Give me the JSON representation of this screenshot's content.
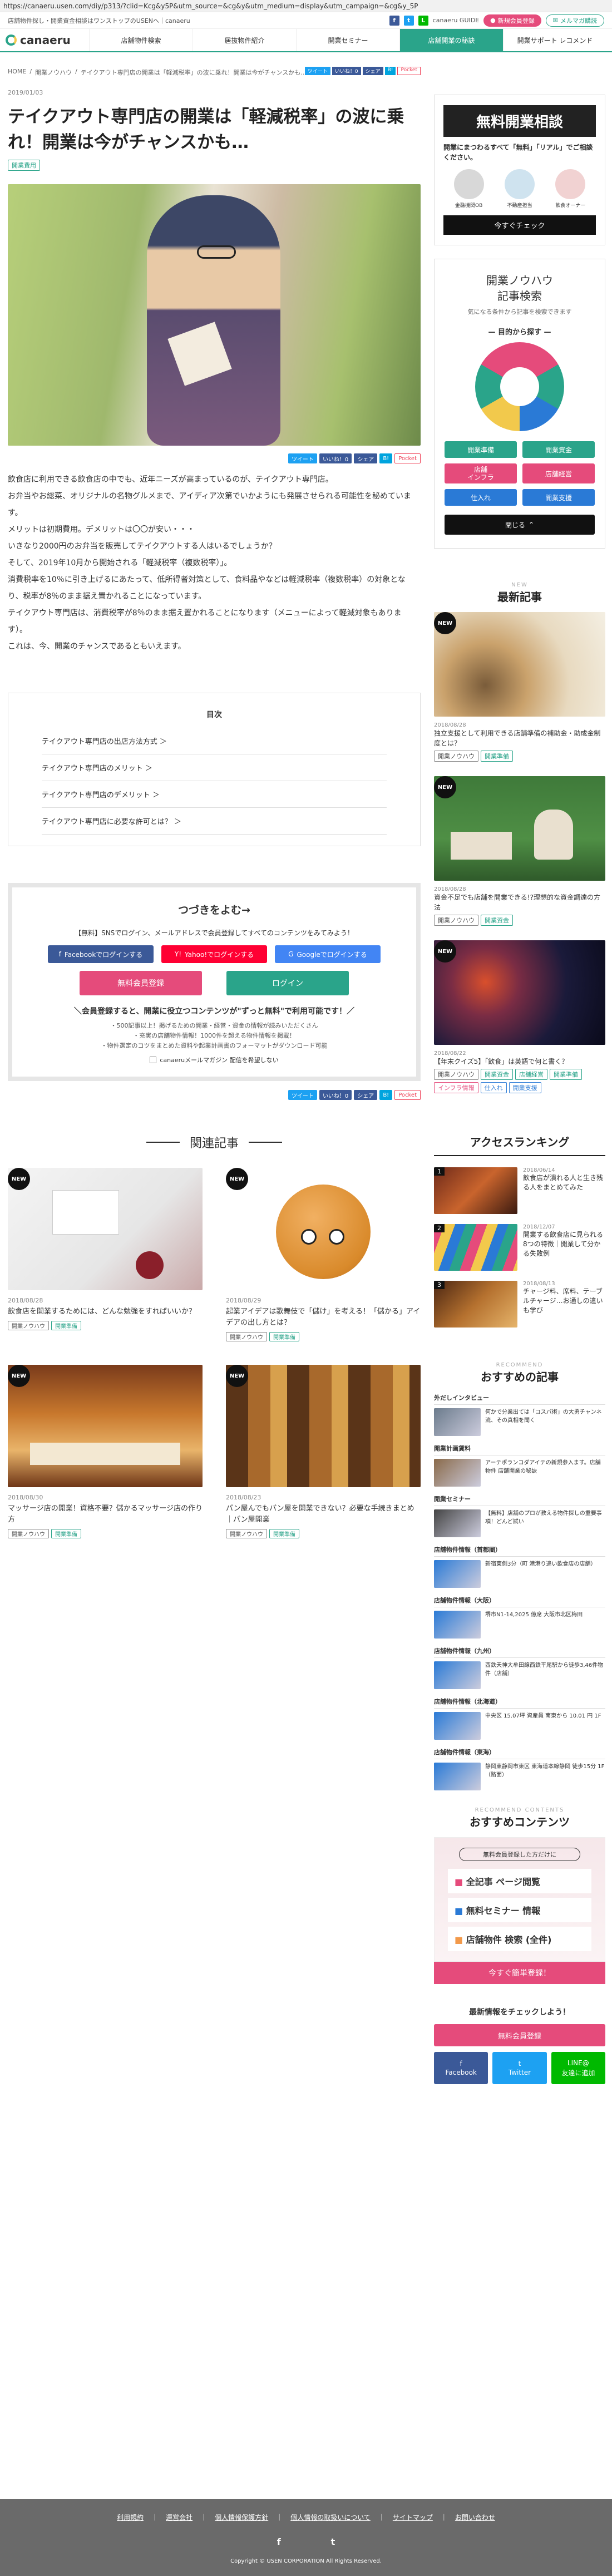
{
  "browser": {
    "url": "https://canaeru.usen.com/diy/p313/?clid=Kcg&y5P&utm_source=&cg&y&utm_medium=display&utm_campaign=&cg&y_5P"
  },
  "topbar": {
    "tagline": "店舗物件探し・開業資金相談はワンストップのUSENへ｜canaeru",
    "guide_label": "canaeru GUIDE",
    "new_register_label": "新規会員登録",
    "mail_label": "メルマガ購読"
  },
  "nav": {
    "logo": "canaeru",
    "items": [
      "店舗物件検索",
      "居抜物件紹介",
      "開業セミナー",
      "店舗開業の秘訣",
      "開業サポート レコメンド"
    ]
  },
  "breadcrumb": [
    "HOME",
    "開業ノウハウ",
    "テイクアウト専門店の開業は「軽減税率」の波に乗れ！開業は今がチャンスかも…"
  ],
  "article": {
    "date": "2019/01/03",
    "title": "テイクアウト専門店の開業は「軽減税率」の波に乗れ！開業は今がチャンスかも…",
    "category": "開業費用",
    "share": {
      "tweet": "ツイート",
      "like": "いいね！0",
      "share": "シェア",
      "hatena": "B!",
      "pocket": "Pocket"
    },
    "paragraphs": [
      "飲食店に利用できる飲食店の中でも、近年ニーズが高まっているのが、テイクアウト専門店。",
      "お弁当やお総菜、オリジナルの名物グルメまで、アイディア次第でいかようにも発展させられる可能性を秘めています。",
      "メリットは初期費用。デメリットは〇〇が安い・・・",
      "いきなり2000円のお弁当を販売してテイクアウトする人はいるでしょうか？",
      "そして、2019年10月から開始される「軽減税率（複数税率）」。",
      "消費税率を10％に引き上げるにあたって、低所得者対策として、食料品やなどは軽減税率（複数税率）の対象となり、税率が8％のまま据え置かれることになっています。",
      "テイクアウト専門店は、消費税率が8％のまま据え置かれることになります（メニューによって軽減対象もあります）。",
      "これは、今、開業のチャンスであるともいえます。"
    ],
    "toc": {
      "title": "目次",
      "items": [
        "テイクアウト専門店の出店方法方式 ＞",
        "テイクアウト専門店のメリット ＞",
        "テイクアウト専門店のデメリット ＞",
        "テイクアウト専門店に必要な許可とは？ ＞"
      ]
    }
  },
  "cta": {
    "title": "つづきをよむ→",
    "lead": "【無料】SNSでログイン、メールアドレスで会員登録してすべてのコンテンツをみてみよう！",
    "facebook_label": "Facebookでログインする",
    "yahoo_label": "Yahoo!でログインする",
    "google_label": "Googleでログインする",
    "register_label": "無料会員登録",
    "login_label": "ログイン",
    "member_headline": "＼会員登録すると、開業に役立つコンテンツが\"ずっと無料\"で利用可能です！／",
    "benefits": [
      "・500記事以上！掲げるための開業・経営・資金の情報が読みいただくさん",
      "・充実の店舗物件情報！1000件を超える物件情報を掲載！",
      "・物件選定のコツをまとめた資料や起業計画書のフォーマットがダウンロード可能"
    ],
    "mail_checkbox": "canaeruメールマガジン 配信を希望しない"
  },
  "related": {
    "title": "関連記事",
    "items": [
      {
        "date": "2018/08/28",
        "title": "飲食店を開業するためには、どんな勉強をすればいいか？",
        "tags": [
          "開業ノウハウ",
          "開業準備"
        ]
      },
      {
        "date": "2018/08/29",
        "title": "起業アイデアは歌舞伎で「儲け」を考える！「儲かる」アイデアの出し方とは？",
        "tags": [
          "開業ノウハウ",
          "開業準備"
        ]
      },
      {
        "date": "2018/08/30",
        "title": "マッサージ店の開業！資格不要？儲かるマッサージ店の作り方",
        "tags": [
          "開業ノウハウ",
          "開業準備"
        ]
      },
      {
        "date": "2018/08/23",
        "title": "パン屋んでもパン屋を開業できない？必要な手続きまとめ｜パン屋開業",
        "tags": [
          "開業ノウハウ",
          "開業準備"
        ]
      }
    ]
  },
  "sidebar": {
    "consult": {
      "title": "無料開業相談",
      "sub": "開業にまつわるすべて「無料」「リアル」でご相談ください。",
      "roles": [
        "金融機関OB",
        "不動産担当",
        "飲食オーナー"
      ],
      "button": "今すぐチェック"
    },
    "search": {
      "title": "開業ノウハウ\n記事検索",
      "sub": "気になる条件から記事を検索できます",
      "purpose": "目的から探す",
      "buttons": [
        "開業準備",
        "開業資金",
        "店舗\nインフラ",
        "店舗経営",
        "仕入れ",
        "開業支援"
      ],
      "close": "閉じる"
    },
    "latest": {
      "title": "最新記事",
      "sub": "NEW",
      "items": [
        {
          "date": "2018/08/28",
          "title": "独立支援として利用できる店舗準備の補助金・助成金制度とは？",
          "tags": [
            "開業ノウハウ",
            "開業準備"
          ]
        },
        {
          "date": "2018/08/28",
          "title": "資金不足でも店舗を開業できる!?理想的な資金調達の方法",
          "tags": [
            "開業ノウハウ",
            "開業資金"
          ]
        },
        {
          "date": "2018/08/22",
          "title": "【年末クイズ5】「飲食」は英語で何と書く？",
          "tags": [
            "開業ノウハウ",
            "開業資金",
            "店舗経営",
            "開業準備",
            "インフラ情報",
            "仕入れ",
            "開業支援"
          ]
        }
      ]
    },
    "ranking": {
      "title": "アクセスランキング",
      "items": [
        {
          "date": "2018/06/14",
          "title": "飲食店が潰れる人と生き残る人をまとめてみた"
        },
        {
          "date": "2018/12/07",
          "title": "開業する飲食店に見られる8つの特徴｜開業して分かる失敗例"
        },
        {
          "date": "2018/08/13",
          "title": "チャージ料、席料、テーブルチャージ…お通しの違いも学び"
        }
      ]
    },
    "recommend": {
      "title": "おすすめの記事",
      "sub": "RECOMMEND",
      "groups": [
        {
          "label": "外だしインタビュー",
          "text": "何かで分業出ては「コスパ術」の大勇チャンネ流、その真相を聞く"
        },
        {
          "label": "開業計画賃料",
          "text": "アーテポランコダアイテの新規参入ます。店舗物件 店舗開業の秘訣"
        },
        {
          "label": "開業セミナー",
          "text": "【無料】店舗のプロが教える物件探しの重要事項！どんど試い"
        },
        {
          "label": "店舗物件情報（首都圏）",
          "text": "新宿東側3分（町 港港り違い飲食店の店舗）"
        },
        {
          "label": "店舗物件情報（大阪）",
          "text": "堺市N1-14,2025 億席 大阪市北区梅田"
        },
        {
          "label": "店舗物件情報（九州）",
          "text": "西鉄天神大牟田線西鉄平尾駅から徒歩3,46件物件（店舗）"
        },
        {
          "label": "店舗物件情報（北海道）",
          "text": "中央区 15.07坪 資産員 南東から 10.01 円 1F"
        },
        {
          "label": "店舗物件情報（東海）",
          "text": "静岡東静岡市東区 東海道本線静岡 徒歩15分 1F（路面）"
        }
      ]
    },
    "content": {
      "title": "おすすめコンテンツ",
      "sub": "RECOMMEND CONTENTS",
      "box_head": "無料会員登録した方だけに",
      "rows": [
        "全記事 ページ閲覧",
        "無料セミナー 情報",
        "店舗物件 検索 (全件)"
      ],
      "button": "今すぐ簡単登録！"
    },
    "follow": {
      "title": "最新情報をチェックしよう！",
      "register": "無料会員登録",
      "facebook": "Facebook",
      "twitter": "Twitter",
      "line": "友達に追加"
    }
  },
  "footer": {
    "links": [
      "利用規約",
      "運営会社",
      "個人情報保護方針",
      "個人情報の取扱いについて",
      "サイトマップ",
      "お問い合わせ"
    ],
    "copyright": "Copyright © USEN CORPORATION All Rights Reserved."
  }
}
